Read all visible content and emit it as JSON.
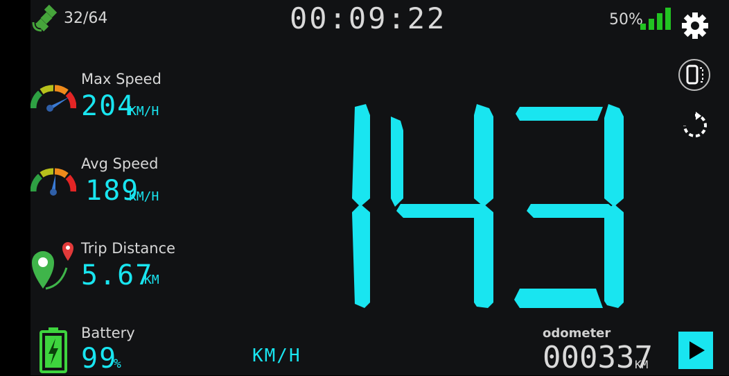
{
  "status": {
    "satellites": "32/64",
    "timer": "00:09:22",
    "battery_signal": "50%"
  },
  "stats": {
    "max_speed": {
      "label": "Max Speed",
      "value": "204",
      "unit": "KM/H"
    },
    "avg_speed": {
      "label": "Avg Speed",
      "value": "189",
      "unit": "KM/H"
    },
    "trip_distance": {
      "label": "Trip Distance",
      "value": "5.67",
      "unit": "KM"
    },
    "battery": {
      "label": "Battery",
      "value": "99",
      "unit": "%"
    }
  },
  "speed": {
    "value": "143",
    "unit": "KM/H"
  },
  "odometer": {
    "label": "odometer",
    "value": "000337",
    "unit": "KM"
  },
  "icons": {
    "satellite": "satellite-icon",
    "signal": "signal-bars-icon",
    "settings": "gear-icon",
    "mirror": "mirror-phone-icon",
    "reset": "reset-icon",
    "play": "play-icon"
  },
  "colors": {
    "accent": "#19e5f0",
    "signal": "#22c322",
    "pin": "#3fb54a"
  }
}
